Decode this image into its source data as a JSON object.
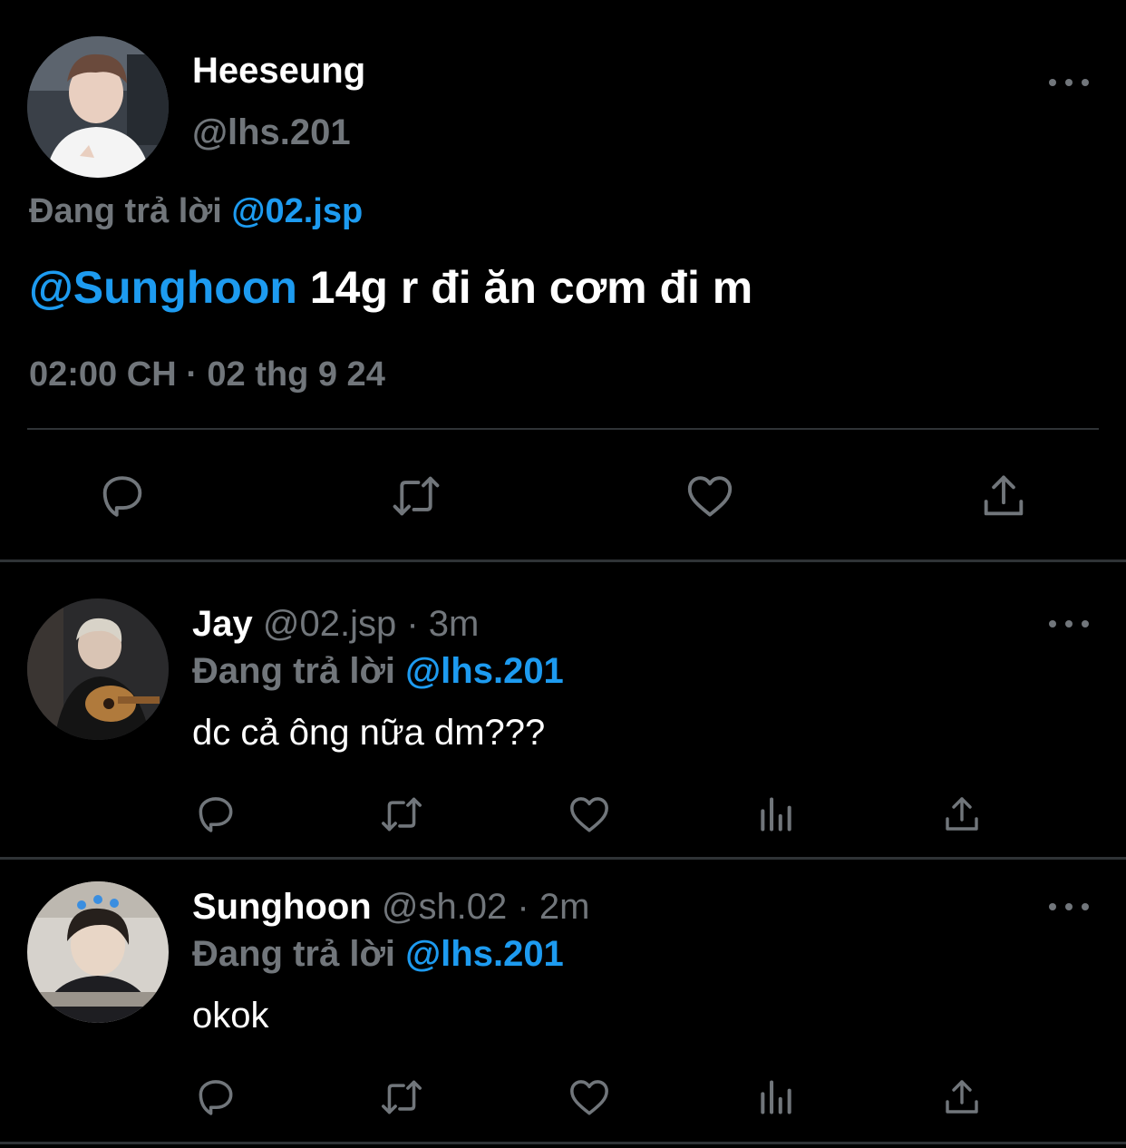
{
  "main_tweet": {
    "display_name": "Heeseung",
    "handle": "@lhs.201",
    "replying_prefix": "Đang trả lời",
    "replying_to": "@02.jsp",
    "mention": "@Sunghoon",
    "text": " 14g r đi ăn cơm đi m",
    "timestamp": "02:00 CH · 02 thg 9 24",
    "actions": [
      "reply-icon",
      "retweet-icon",
      "like-icon",
      "share-icon"
    ]
  },
  "replies": [
    {
      "display_name": "Jay",
      "meta": " @02.jsp · 3m",
      "replying_prefix": "Đang trả lời",
      "replying_to": "@lhs.201",
      "text": "dc cả ông nữa dm???",
      "actions": [
        "reply-icon",
        "retweet-icon",
        "like-icon",
        "analytics-icon",
        "share-icon"
      ]
    },
    {
      "display_name": "Sunghoon",
      "meta": " @sh.02 · 2m",
      "replying_prefix": "Đang trả lời",
      "replying_to": "@lhs.201",
      "text": "okok",
      "actions": [
        "reply-icon",
        "retweet-icon",
        "like-icon",
        "analytics-icon",
        "share-icon"
      ]
    }
  ],
  "colors": {
    "background": "#000000",
    "primary_text": "#ffffff",
    "secondary_text": "#71767b",
    "link": "#1d9bf0",
    "divider": "#2f3336"
  }
}
